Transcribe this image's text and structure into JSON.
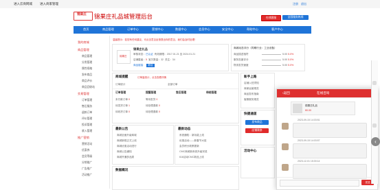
{
  "topbar": {
    "links": [
      "进入云商网城",
      "进入商家管理"
    ]
  },
  "header": {
    "logo": "锦果庄",
    "title": "锦果庄礼品城管理后台",
    "contact": "在线客服",
    "hotline": "全国服务热线",
    "login_link": "注册",
    "logout_link": "退出"
  },
  "nav": {
    "items": [
      "首页",
      "商品管理",
      "订单中心",
      "营销中心",
      "数据中心",
      "会员中心",
      "安全中心",
      "帮助中心",
      "客户中心"
    ]
  },
  "sidebar": {
    "groups": [
      {
        "title": "我的商城",
        "items": []
      },
      {
        "title": "商品管理",
        "items": [
          "商品管理",
          "分类管理",
          "属性规格",
          "发布商品",
          "商品评价",
          "商品回收站"
        ]
      },
      {
        "title": "交易管理",
        "items": [
          "订单管理",
          "售后服务",
          "退款订单",
          "评价管理",
          "投诉管理",
          "收入管理"
        ]
      },
      {
        "title": "推广营销",
        "items": [
          "营销活动",
          "优惠券",
          "会员等级",
          "分销推广",
          "广告推广",
          "活动推广"
        ]
      }
    ]
  },
  "notice": "温馨提示：若您有任何建议，可点击意见反馈提出你的意见，我们会及时处理！",
  "profile": {
    "name": "锦果庄礼品",
    "status_label": "审核状态：",
    "status": "已认证",
    "valid_label": "有效期限：",
    "valid": "2017.01.21 至 2024.01.21",
    "rating_label": "店铺星级：",
    "rating": "5",
    "sold_label": "宝贝数量：",
    "sold": "32",
    "fans_label": "关注：",
    "fans": "34",
    "link": "商品链接",
    "button": "新店"
  },
  "score": {
    "title": "商城动态评分（同期行业：工业设备）",
    "rows": [
      {
        "label": "商品描述相符",
        "value": "5.00",
        "delta": "5.0%"
      },
      {
        "label": "服务态度评分",
        "value": "5.00",
        "delta": "5.0%"
      },
      {
        "label": "物流发货速度",
        "value": "5.00",
        "delta": "5.0%"
      }
    ]
  },
  "store_panel": {
    "title": "商城提醒",
    "note": "订单量统计，点击查看详情",
    "order_label": "订单统计",
    "order_sub": "全部订单",
    "headers": [
      "订单管理",
      "提醒管理",
      "售后管理",
      "待结管理"
    ],
    "rows": [
      [
        "未付款订单",
        "0",
        "等待发货",
        "0"
      ],
      [
        "待发货订单",
        "1",
        "待处理退款",
        "0"
      ],
      [
        "待收货订单",
        "0",
        "待处理退款",
        "0"
      ]
    ]
  },
  "news": {
    "title1": "最新公告",
    "items1": [
      "商城全面升级商城",
      "商城新规正式上线",
      "商城优惠活动进行",
      "商城公告通知",
      "商城开通多品类"
    ],
    "title2": "最新动态",
    "items2": [
      "系统通知：新功能上线",
      "优惠活动——新春节大促",
      "会员积分政策更新",
      "CMC商城新系统升级完成",
      "618活动CMC新品上线"
    ]
  },
  "bottom": {
    "title": "数据概况"
  },
  "right_sidebar": {
    "title": "新手上路",
    "items": [
      "店铺入驻须知",
      "商家运营规范",
      "商品发布指南",
      "客服服务规范"
    ],
    "section2": "快捷通道",
    "btn1": "发布商品",
    "btn2": "店铺装修",
    "section3": "活动中心"
  },
  "chat": {
    "back": "返回",
    "title": "在线咨询",
    "product_name": "锦果庄礼品",
    "product_price": "¥0.00",
    "times": [
      "2023-09-15 14:03:51",
      "2023-09-15 14:03:57",
      "2023-12-01 15:00:14"
    ],
    "send": "发送"
  }
}
